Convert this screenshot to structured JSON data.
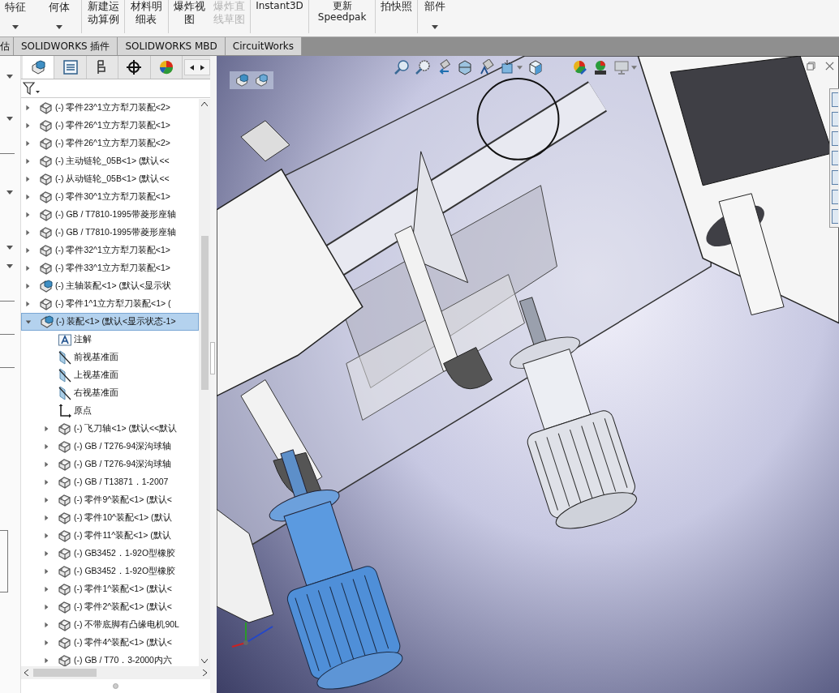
{
  "toolbar": [
    {
      "label": "特征",
      "dropdown": true,
      "disabled": false
    },
    {
      "label": "何体",
      "dropdown": true,
      "disabled": false
    },
    {
      "label": "新建运动算例",
      "dropdown": false,
      "disabled": false
    },
    {
      "label": "材料明细表",
      "dropdown": false,
      "disabled": false
    },
    {
      "label": "爆炸视图",
      "dropdown": false,
      "disabled": false
    },
    {
      "label": "爆炸直线草图",
      "dropdown": false,
      "disabled": true
    },
    {
      "label": "Instant3D",
      "dropdown": false,
      "disabled": false
    },
    {
      "label": "更新 Speedpak",
      "dropdown": false,
      "disabled": false
    },
    {
      "label": "拍快照",
      "dropdown": false,
      "disabled": false
    },
    {
      "label": "部件",
      "dropdown": true,
      "disabled": false
    }
  ],
  "command_tabs": [
    {
      "label": "估",
      "selected": false
    },
    {
      "label": "SOLIDWORKS 插件",
      "selected": false
    },
    {
      "label": "SOLIDWORKS MBD",
      "selected": false
    },
    {
      "label": "CircuitWorks",
      "selected": false
    }
  ],
  "panel_tabs": [
    {
      "kind": "feature_tree",
      "selected": true
    },
    {
      "kind": "property",
      "selected": false
    },
    {
      "kind": "configuration",
      "selected": false
    },
    {
      "kind": "dimxpert",
      "selected": false
    },
    {
      "kind": "display",
      "selected": false
    }
  ],
  "tree": [
    {
      "kind": "part",
      "label": "(-) 零件23^1立方犁刀装配<2>",
      "expanded": false,
      "selected": false
    },
    {
      "kind": "part",
      "label": "(-) 零件26^1立方犁刀装配<1>",
      "expanded": false,
      "selected": false
    },
    {
      "kind": "part",
      "label": "(-) 零件26^1立方犁刀装配<2>",
      "expanded": false,
      "selected": false
    },
    {
      "kind": "part",
      "label": "(-) 主动链轮_05B<1> (默认<<",
      "expanded": false,
      "selected": false
    },
    {
      "kind": "part",
      "label": "(-) 从动链轮_05B<1> (默认<<",
      "expanded": false,
      "selected": false
    },
    {
      "kind": "part",
      "label": "(-) 零件30^1立方犁刀装配<1>",
      "expanded": false,
      "selected": false
    },
    {
      "kind": "part",
      "label": "(-) GB / T7810-1995带菱形座轴",
      "expanded": false,
      "selected": false
    },
    {
      "kind": "part",
      "label": "(-) GB / T7810-1995带菱形座轴",
      "expanded": false,
      "selected": false
    },
    {
      "kind": "part",
      "label": "(-) 零件32^1立方犁刀装配<1>",
      "expanded": false,
      "selected": false
    },
    {
      "kind": "part",
      "label": "(-) 零件33^1立方犁刀装配<1>",
      "expanded": false,
      "selected": false
    },
    {
      "kind": "assembly",
      "label": "(-) 主轴装配<1> (默认<显示状",
      "expanded": false,
      "selected": false
    },
    {
      "kind": "part",
      "label": "(-) 零件1^1立方犁刀装配<1> (",
      "expanded": false,
      "selected": false
    },
    {
      "kind": "assembly",
      "label": "(-) 装配<1> (默认<显示状态-1>",
      "expanded": true,
      "selected": true,
      "children": [
        {
          "kind": "annotation",
          "label": "注解",
          "selected": false
        },
        {
          "kind": "plane",
          "label": "前视基准面",
          "selected": false
        },
        {
          "kind": "plane",
          "label": "上视基准面",
          "selected": false
        },
        {
          "kind": "plane",
          "label": "右视基准面",
          "selected": false
        },
        {
          "kind": "origin",
          "label": "原点",
          "selected": false
        },
        {
          "kind": "part",
          "label": "(-) 飞刀轴<1> (默认<<默认",
          "expanded": false,
          "selected": false
        },
        {
          "kind": "part",
          "label": "(-) GB / T276-94深沟球轴",
          "expanded": false,
          "selected": false
        },
        {
          "kind": "part",
          "label": "(-) GB / T276-94深沟球轴",
          "expanded": false,
          "selected": false
        },
        {
          "kind": "part",
          "label": "(-) GB / T13871．1-2007",
          "expanded": false,
          "selected": false
        },
        {
          "kind": "part",
          "label": "(-) 零件9^装配<1> (默认<",
          "expanded": false,
          "selected": false
        },
        {
          "kind": "part",
          "label": "(-) 零件10^装配<1> (默认",
          "expanded": false,
          "selected": false
        },
        {
          "kind": "part",
          "label": "(-) 零件11^装配<1> (默认",
          "expanded": false,
          "selected": false
        },
        {
          "kind": "part",
          "label": "(-) GB3452．1-92O型橡胶",
          "expanded": false,
          "selected": false
        },
        {
          "kind": "part",
          "label": "(-) GB3452．1-92O型橡胶",
          "expanded": false,
          "selected": false
        },
        {
          "kind": "part",
          "label": "(-) 零件1^装配<1> (默认<",
          "expanded": false,
          "selected": false
        },
        {
          "kind": "part",
          "label": "(-) 零件2^装配<1> (默认<",
          "expanded": false,
          "selected": false
        },
        {
          "kind": "part",
          "label": "(-) 不带底脚有凸缘电机90L",
          "expanded": false,
          "selected": false
        },
        {
          "kind": "part",
          "label": "(-) 零件4^装配<1> (默认<",
          "expanded": false,
          "selected": false
        },
        {
          "kind": "part",
          "label": "(-) GB / T70．3-2000内六",
          "expanded": false,
          "selected": false
        }
      ]
    }
  ]
}
